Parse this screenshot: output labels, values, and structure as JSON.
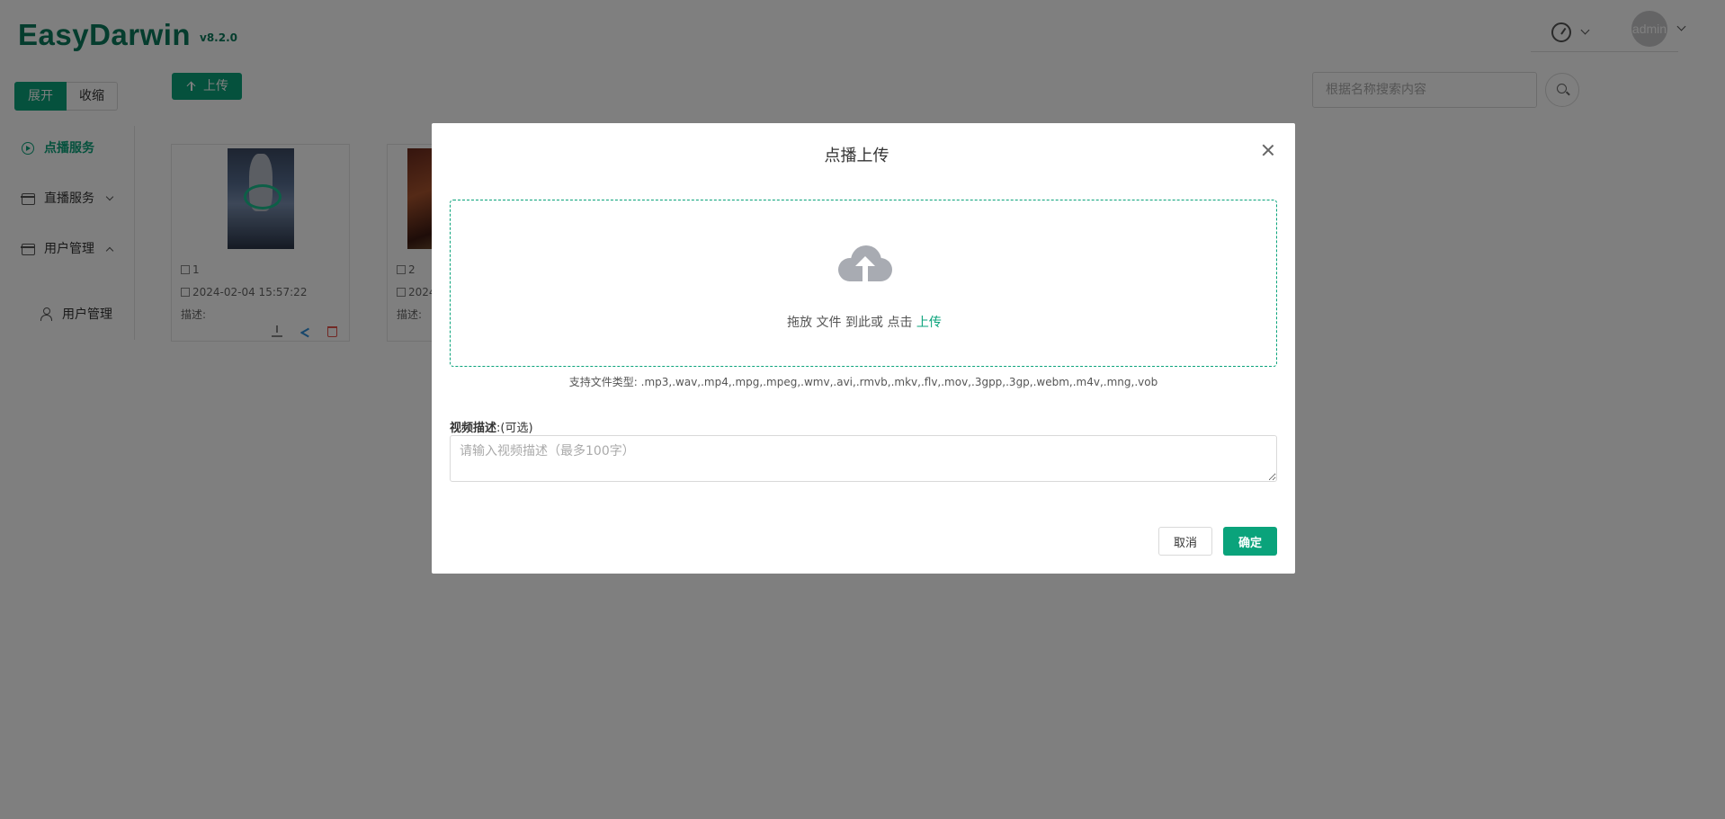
{
  "header": {
    "logo": "EasyDarwin",
    "version": "v8.2.0",
    "user": "admin",
    "dashboard_icon": "dashboard-gauge-icon"
  },
  "toolbar": {
    "expand_label": "展开",
    "collapse_label": "收缩",
    "upload_label": "上传",
    "search_placeholder": "根据名称搜索内容"
  },
  "sidebar": {
    "items": [
      {
        "label": "点播服务",
        "icon": "play-circle-icon",
        "active": true
      },
      {
        "label": "直播服务",
        "icon": "folder-icon",
        "expand": "down"
      },
      {
        "label": "用户管理",
        "icon": "folder-icon",
        "expand": "up"
      }
    ],
    "sub_items": [
      {
        "label": "用户管理",
        "icon": "user-icon"
      }
    ]
  },
  "cards": [
    {
      "id": "1",
      "date": "2024-02-04 15:57:22",
      "desc_label": "描述:"
    },
    {
      "id": "2",
      "date": "2024",
      "desc_label": "描述:"
    }
  ],
  "modal": {
    "title": "点播上传",
    "drop_text": "拖放 文件 到此或 点击 ",
    "drop_link": "上传",
    "file_types": "支持文件类型: .mp3,.wav,.mp4,.mpg,.mpeg,.wmv,.avi,.rmvb,.mkv,.flv,.mov,.3gpp,.3gp,.webm,.m4v,.mng,.vob",
    "desc_label": "视频描述",
    "desc_optional": ":(可选)",
    "desc_placeholder": "请输入视频描述（最多100字）",
    "cancel_label": "取消",
    "ok_label": "确定"
  },
  "colors": {
    "accent": "#0aa37b",
    "logo": "#0b7a5c",
    "overlay": "rgba(0,0,0,0.5)",
    "danger": "#e5534b",
    "share": "#2e8fd8"
  }
}
